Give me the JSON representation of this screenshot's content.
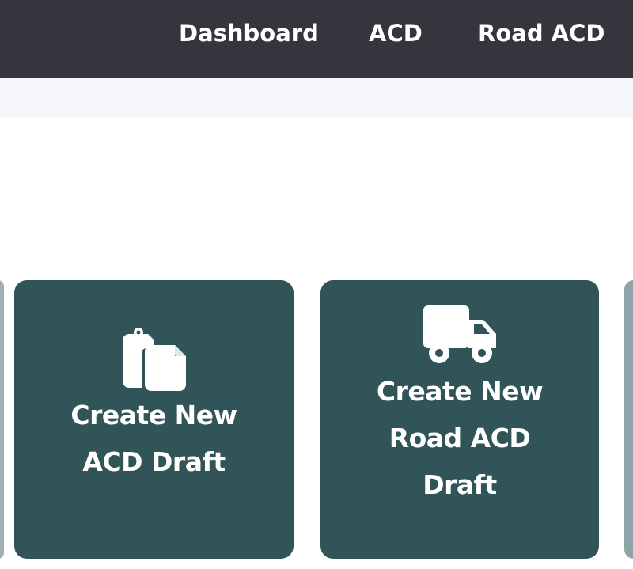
{
  "nav": {
    "items": [
      {
        "label": "Dashboard"
      },
      {
        "label": "ACD"
      },
      {
        "label": "Road ACD"
      }
    ]
  },
  "cards": [
    {
      "label_line1": "Create New",
      "label_line2": "ACD Draft",
      "icon": "copy-documents-icon"
    },
    {
      "label_line1": "Create New",
      "label_line2": "Road ACD",
      "label_line3": "Draft",
      "icon": "truck-icon"
    }
  ],
  "colors": {
    "topbar": "#36353d",
    "subbar": "#f6f7fb",
    "card": "#305457"
  }
}
